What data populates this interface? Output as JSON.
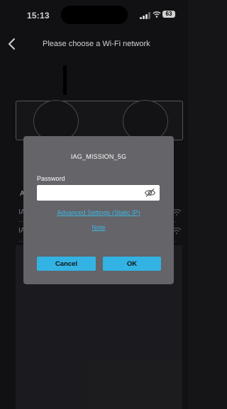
{
  "status_bar": {
    "time": "15:13",
    "battery": "63",
    "icons": [
      "signal-icon",
      "wifi-icon",
      "battery-icon"
    ]
  },
  "nav": {
    "back_icon": "chevron-left-icon",
    "title": "Please choose a Wi-Fi network"
  },
  "network_list": {
    "header": "A",
    "items": [
      {
        "label": "IA",
        "icon": "wifi-icon"
      },
      {
        "label": "IA",
        "icon": "wifi-icon"
      }
    ]
  },
  "dialog": {
    "title": "IAG_MISSION_5G",
    "password_label": "Password",
    "password_value": "",
    "password_placeholder": "",
    "visibility_icon": "eye-off-icon",
    "advanced_link": "Advanced Settings (Static IP)",
    "note_link": "Note",
    "cancel_label": "Cancel",
    "ok_label": "OK"
  },
  "colors": {
    "background": "#151518",
    "dialog_background": "#646469",
    "accent": "#33b3e3",
    "link": "#3fb8e6"
  }
}
